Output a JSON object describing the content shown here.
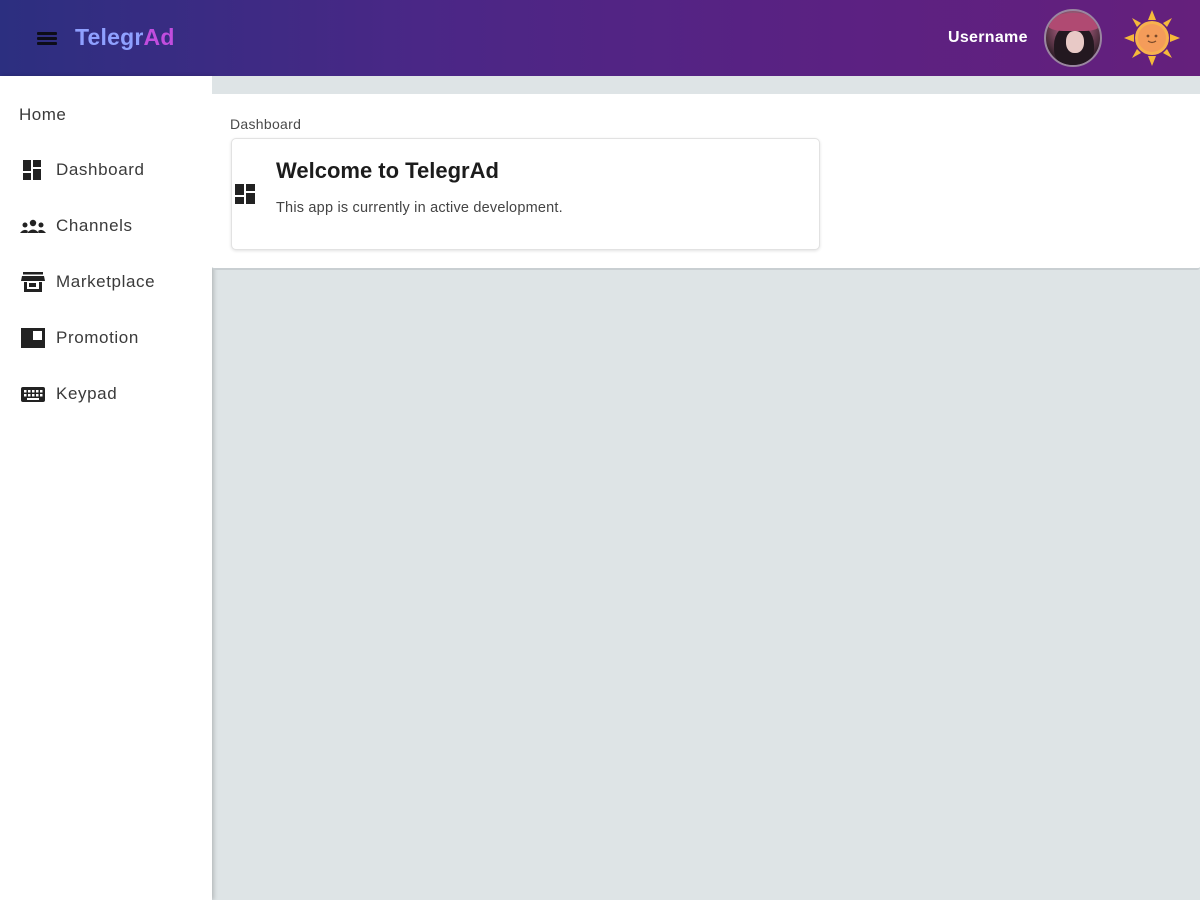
{
  "header": {
    "brand_part1": "Telegr",
    "brand_part2": "Ad",
    "username": "Username",
    "colors": {
      "gradient_start": "#2c2f80",
      "gradient_end": "#65207c",
      "brand_blue": "#8fa0ff",
      "brand_purple": "#c14dde"
    },
    "icons": [
      "menu-icon",
      "avatar",
      "sun-icon"
    ]
  },
  "sidebar": {
    "home_label": "Home",
    "items": [
      {
        "label": "Dashboard",
        "icon": "dashboard-icon"
      },
      {
        "label": "Channels",
        "icon": "groups-icon"
      },
      {
        "label": "Marketplace",
        "icon": "store-icon"
      },
      {
        "label": "Promotion",
        "icon": "promotion-icon"
      },
      {
        "label": "Keypad",
        "icon": "keyboard-icon"
      }
    ]
  },
  "main": {
    "breadcrumb": "Dashboard",
    "card": {
      "title": "Welcome to TelegrAd",
      "text": "This app is currently in active development.",
      "icon": "dashboard-icon"
    }
  }
}
